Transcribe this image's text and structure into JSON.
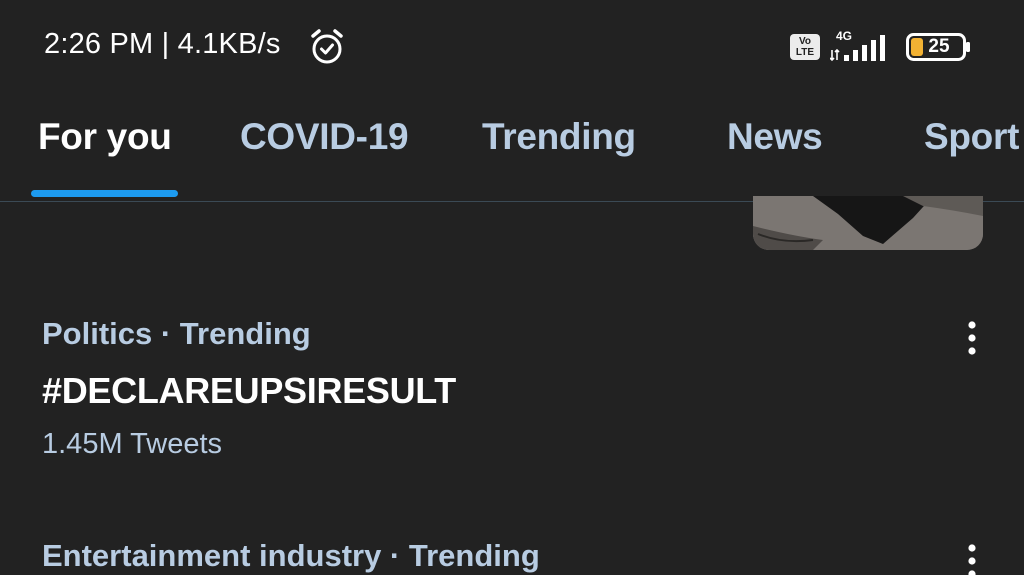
{
  "status_bar": {
    "time_speed": "2:26 PM | 4.1KB/s",
    "volte_top": "Vo",
    "volte_bottom": "LTE",
    "network_type": "4G",
    "battery_level": "25",
    "icons": [
      "alarm-icon",
      "volte-icon",
      "signal-icon",
      "battery-icon"
    ]
  },
  "tabs": [
    {
      "label": "For you",
      "active": true
    },
    {
      "label": "COVID-19",
      "active": false
    },
    {
      "label": "Trending",
      "active": false
    },
    {
      "label": "News",
      "active": false
    },
    {
      "label": "Sport",
      "active": false
    }
  ],
  "accent_color": "#1d9bf0",
  "trends": [
    {
      "context": "Politics · Trending",
      "title": "#DECLAREUPSIRESULT",
      "count": "1.45M Tweets"
    },
    {
      "context": "Entertainment industry · Trending",
      "title": "",
      "count": ""
    }
  ]
}
